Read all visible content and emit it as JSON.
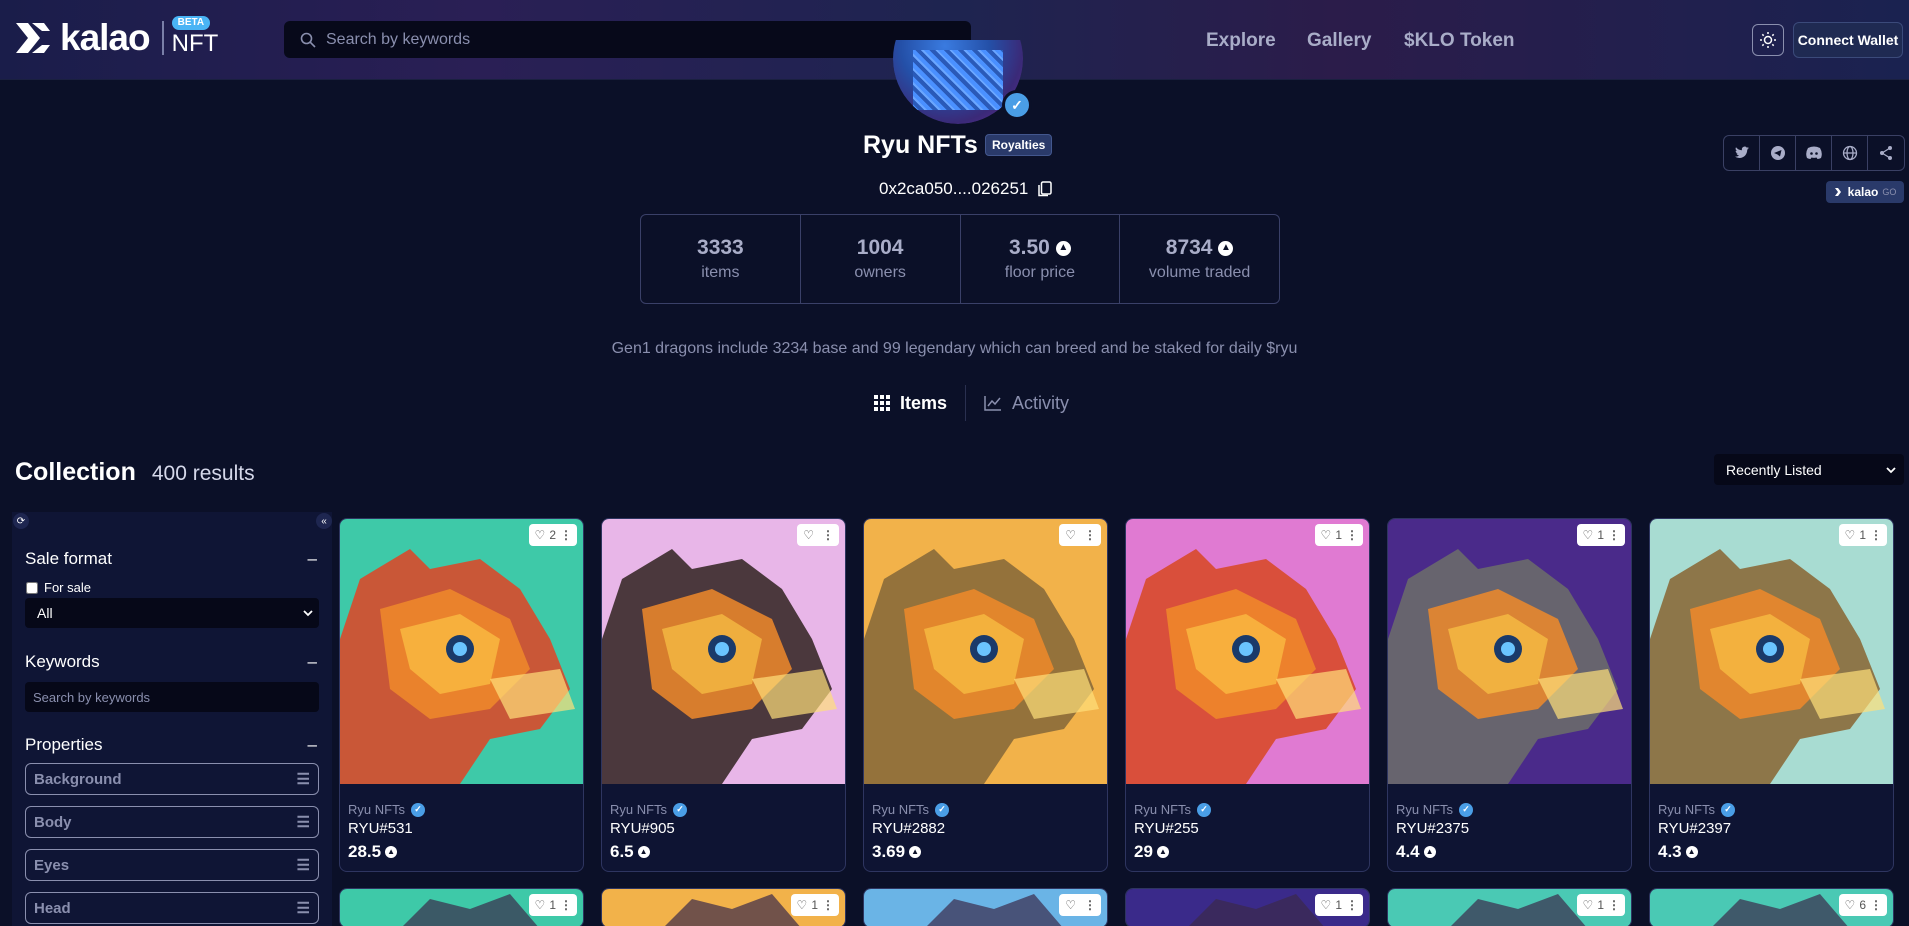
{
  "header": {
    "logo_text": "kalao",
    "logo_badge": "BETA",
    "logo_suffix": "NFT",
    "search_placeholder": "Search by keywords",
    "nav": [
      "Explore",
      "Gallery",
      "$KLO Token"
    ],
    "connect_label": "Connect Wallet"
  },
  "collection": {
    "name": "Ryu NFTs",
    "royalties_label": "Royalties",
    "address": "0x2ca050....026251",
    "stats": [
      {
        "value": "3333",
        "label": "items",
        "avax": false
      },
      {
        "value": "1004",
        "label": "owners",
        "avax": false
      },
      {
        "value": "3.50",
        "label": "floor price",
        "avax": true
      },
      {
        "value": "8734",
        "label": "volume traded",
        "avax": true
      }
    ],
    "description": "Gen1 dragons include 3234 base and 99 legendary which can breed and be staked for daily $ryu",
    "kalao_go": "kalao",
    "kalao_go_small": "GO"
  },
  "tabs": {
    "items": "Items",
    "activity": "Activity"
  },
  "results": {
    "title": "Collection",
    "count": "400 results",
    "sort": "Recently Listed"
  },
  "sidebar": {
    "sale_format": "Sale format",
    "for_sale": "For sale",
    "sale_select": "All",
    "keywords": "Keywords",
    "keywords_placeholder": "Search by keywords",
    "properties": "Properties",
    "props": [
      "Background",
      "Body",
      "Eyes",
      "Head"
    ]
  },
  "cards": [
    {
      "collection": "Ryu NFTs",
      "name": "RYU#531",
      "price": "28.5",
      "likes": "2",
      "bg": "#3ec9a8",
      "accent": "#d84a2a"
    },
    {
      "collection": "Ryu NFTs",
      "name": "RYU#905",
      "price": "6.5",
      "likes": "",
      "bg": "#e8b6e8",
      "accent": "#3a2a2a"
    },
    {
      "collection": "Ryu NFTs",
      "name": "RYU#2882",
      "price": "3.69",
      "likes": "",
      "bg": "#f2b24a",
      "accent": "#8a6a3a"
    },
    {
      "collection": "Ryu NFTs",
      "name": "RYU#255",
      "price": "29",
      "likes": "1",
      "bg": "#e07ad2",
      "accent": "#d84a2a"
    },
    {
      "collection": "Ryu NFTs",
      "name": "RYU#2375",
      "price": "4.4",
      "likes": "1",
      "bg": "#4a2a8a",
      "accent": "#6a6a6a"
    },
    {
      "collection": "Ryu NFTs",
      "name": "RYU#2397",
      "price": "4.3",
      "likes": "1",
      "bg": "#a8dcd2",
      "accent": "#8a6a3a"
    }
  ],
  "row2_likes": [
    "1",
    "1",
    "",
    "1",
    "1",
    "6"
  ],
  "row2_bg": [
    "#3ec9a8",
    "#f2b24a",
    "#6ab4e6",
    "#3a2a8a",
    "#4ac9b4",
    "#4ac9b4"
  ]
}
